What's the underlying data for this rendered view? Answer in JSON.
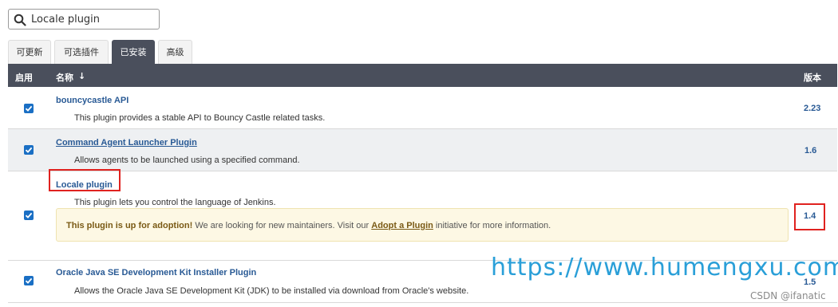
{
  "search": {
    "value": "Locale plugin"
  },
  "tabs": [
    {
      "label": "可更新"
    },
    {
      "label": "可选插件"
    },
    {
      "label": "已安装"
    },
    {
      "label": "高级"
    }
  ],
  "table": {
    "headers": {
      "enabled": "启用",
      "name": "名称",
      "sort": "↓",
      "version": "版本"
    },
    "rows": [
      {
        "name": "bouncycastle API",
        "description": "This plugin provides a stable API to Bouncy Castle related tasks.",
        "version": "2.23",
        "enabled": true
      },
      {
        "name": "Command Agent Launcher Plugin",
        "description": "Allows agents to be launched using a specified command.",
        "version": "1.6",
        "enabled": true
      },
      {
        "name": "Locale plugin",
        "description": "This plugin lets you control the language of Jenkins.",
        "version": "1.4",
        "enabled": true,
        "adoption": {
          "bold": "This plugin is up for adoption!",
          "text1": " We are looking for new maintainers. Visit our ",
          "link": "Adopt a Plugin",
          "text2": " initiative for more information."
        }
      },
      {
        "name": "Oracle Java SE Development Kit Installer Plugin",
        "description": "Allows the Oracle Java SE Development Kit (JDK) to be installed via download from Oracle's website.",
        "version": "1.5",
        "enabled": true
      }
    ]
  },
  "watermark": "https://www.humengxu.com",
  "credit": "CSDN @ifanatic",
  "colors": {
    "header_bg": "#4a4f5c",
    "link": "#295a95",
    "checkbox": "#1a6fc4",
    "highlight": "#e0221f",
    "adoption_bg": "#fdf8e4"
  }
}
